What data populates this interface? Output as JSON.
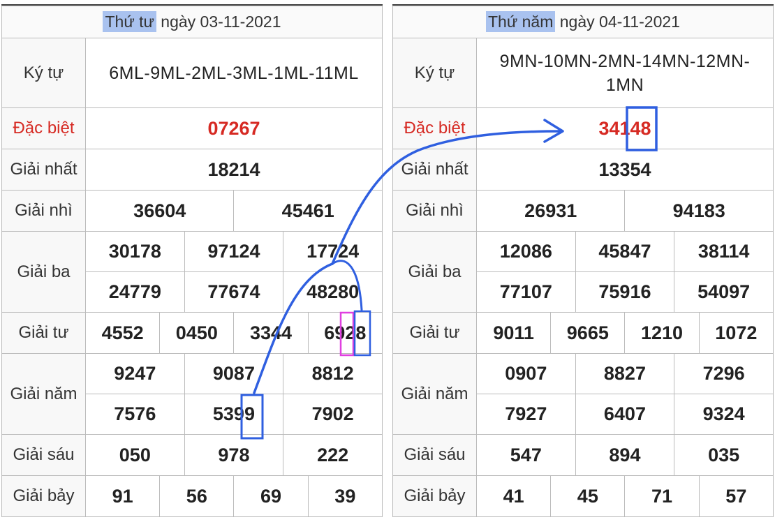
{
  "left": {
    "day_highlight": "Thứ tư",
    "date_text": " ngày 03-11-2021",
    "labels": {
      "kytu": "Ký tự",
      "db": "Đặc biệt",
      "g1": "Giải nhất",
      "g2": "Giải nhì",
      "g3": "Giải ba",
      "g4": "Giải tư",
      "g5": "Giải năm",
      "g6": "Giải sáu",
      "g7": "Giải bảy"
    },
    "kytu": "6ML-9ML-2ML-3ML-1ML-11ML",
    "db": "07267",
    "g1": "18214",
    "g2": [
      "36604",
      "45461"
    ],
    "g3": [
      "30178",
      "97124",
      "17724",
      "24779",
      "77674",
      "48280"
    ],
    "g4": [
      "4552",
      "0450",
      "3344",
      "6928"
    ],
    "g5": [
      "9247",
      "9087",
      "8812",
      "7576",
      "5399",
      "7902"
    ],
    "g6": [
      "050",
      "978",
      "222"
    ],
    "g7": [
      "91",
      "56",
      "69",
      "39"
    ]
  },
  "right": {
    "day_highlight": "Thứ năm",
    "date_text": " ngày 04-11-2021",
    "labels": {
      "kytu": "Ký tự",
      "db": "Đặc biệt",
      "g1": "Giải nhất",
      "g2": "Giải nhì",
      "g3": "Giải ba",
      "g4": "Giải tư",
      "g5": "Giải năm",
      "g6": "Giải sáu",
      "g7": "Giải bảy"
    },
    "kytu": "9MN-10MN-2MN-14MN-12MN-1MN",
    "db": "34148",
    "g1": "13354",
    "g2": [
      "26931",
      "94183"
    ],
    "g3": [
      "12086",
      "45847",
      "38114",
      "77107",
      "75916",
      "54097"
    ],
    "g4": [
      "9011",
      "9665",
      "1210",
      "1072"
    ],
    "g5": [
      "0907",
      "8827",
      "7296",
      "7927",
      "6407",
      "9324"
    ],
    "g6": [
      "547",
      "894",
      "035"
    ],
    "g7": [
      "41",
      "45",
      "71",
      "57"
    ]
  },
  "colors": {
    "special_red": "#d62a23",
    "annotation_blue": "#2f5fe0",
    "annotation_magenta": "#e040e0",
    "day_highlight_bg": "#a9c2ef"
  }
}
